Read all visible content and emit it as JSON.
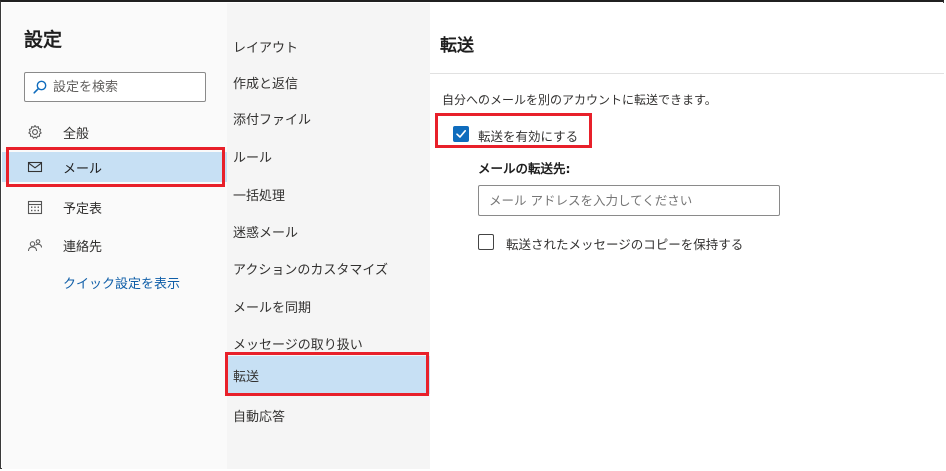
{
  "settings_title": "設定",
  "search": {
    "placeholder": "設定を検索"
  },
  "nav": [
    {
      "label": "全般",
      "icon": "gear-icon"
    },
    {
      "label": "メール",
      "icon": "mail-icon",
      "selected": true
    },
    {
      "label": "予定表",
      "icon": "calendar-icon"
    },
    {
      "label": "連絡先",
      "icon": "people-icon"
    }
  ],
  "quick_settings_link": "クイック設定を表示",
  "mail_submenu": [
    "レイアウト",
    "作成と返信",
    "添付ファイル",
    "ルール",
    "一括処理",
    "迷惑メール",
    "アクションのカスタマイズ",
    "メールを同期",
    "メッセージの取り扱い",
    "転送",
    "自動応答"
  ],
  "selected_submenu": "転送",
  "forwarding": {
    "title": "転送",
    "description": "自分へのメールを別のアカウントに転送できます。",
    "enable_label": "転送を有効にする",
    "enable_checked": true,
    "destination_heading": "メールの転送先:",
    "email_placeholder": "メール アドレスを入力してください",
    "email_value": "",
    "keep_copy_label": "転送されたメッセージのコピーを保持する",
    "keep_copy_checked": false
  },
  "colors": {
    "accent": "#0f6cbd",
    "selected_bg": "#c7e0f4",
    "highlight": "#e8202a",
    "link": "#0f5ea8"
  }
}
